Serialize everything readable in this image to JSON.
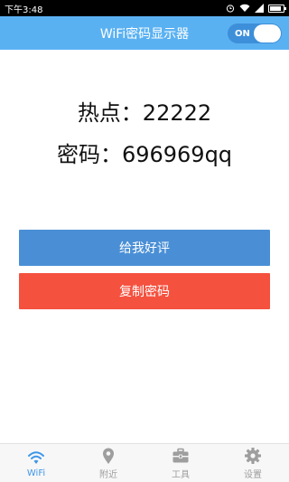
{
  "status_bar": {
    "time": "下午3:48",
    "icons": [
      "alarm-icon",
      "wifi-signal-icon",
      "cellular-signal-icon",
      "battery-icon"
    ],
    "battery_level": 0.85
  },
  "app_bar": {
    "title": "WiFi密码显示器",
    "toggle": {
      "label": "ON",
      "state": "on"
    }
  },
  "main": {
    "hotspot_line": "热点：22222",
    "password_line": "密码：696969qq",
    "rate_button": "给我好评",
    "copy_button": "复制密码"
  },
  "bottom_nav": {
    "active": "WiFi",
    "items": [
      {
        "label": "WiFi",
        "icon": "wifi-icon"
      },
      {
        "label": "附近",
        "icon": "location-pin-icon"
      },
      {
        "label": "工具",
        "icon": "toolbox-icon"
      },
      {
        "label": "设置",
        "icon": "gear-icon"
      }
    ]
  },
  "colors": {
    "status_bar": "#000000",
    "app_bar": "#5ab1f2",
    "toggle_track": "#3d8fd9",
    "rate_button": "#4a8fd6",
    "copy_button": "#f5513f",
    "nav_active": "#3f97e8",
    "nav_inactive": "#9e9e9e"
  }
}
